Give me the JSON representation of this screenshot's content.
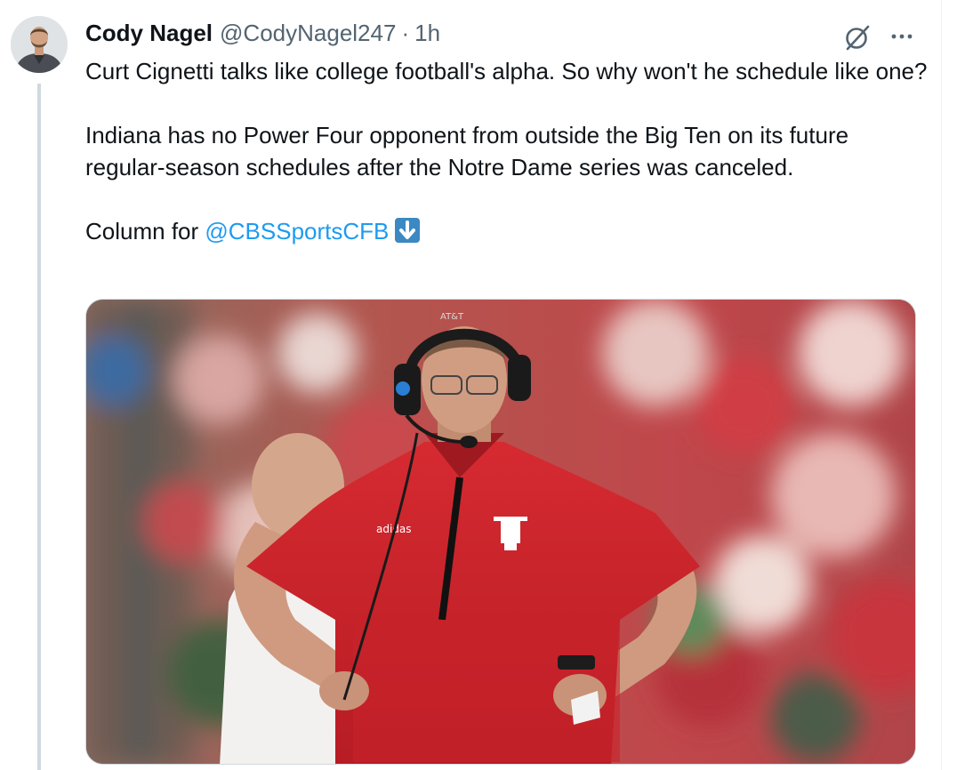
{
  "tweet": {
    "author_name": "Cody Nagel",
    "handle": "@CodyNagel247",
    "separator": "·",
    "time": "1h",
    "text_line1": "Curt Cignetti talks like college football's alpha. So why won't he schedule like one?",
    "text_line2": "Indiana has no Power Four opponent from outside the Big Ten on its future regular-season schedules after the Notre Dame series was canceled.",
    "column_prefix": "Column for ",
    "mention": "@CBSSportsCFB",
    "emoji_name": "down-arrow-emoji",
    "accent_color": "#1d9bf0"
  },
  "icons": {
    "grok": "grok-icon",
    "more": "more-icon"
  },
  "media": {
    "jersey_logo": "IU",
    "jersey_brand": "adidas",
    "headset_brand": "AT&T"
  }
}
